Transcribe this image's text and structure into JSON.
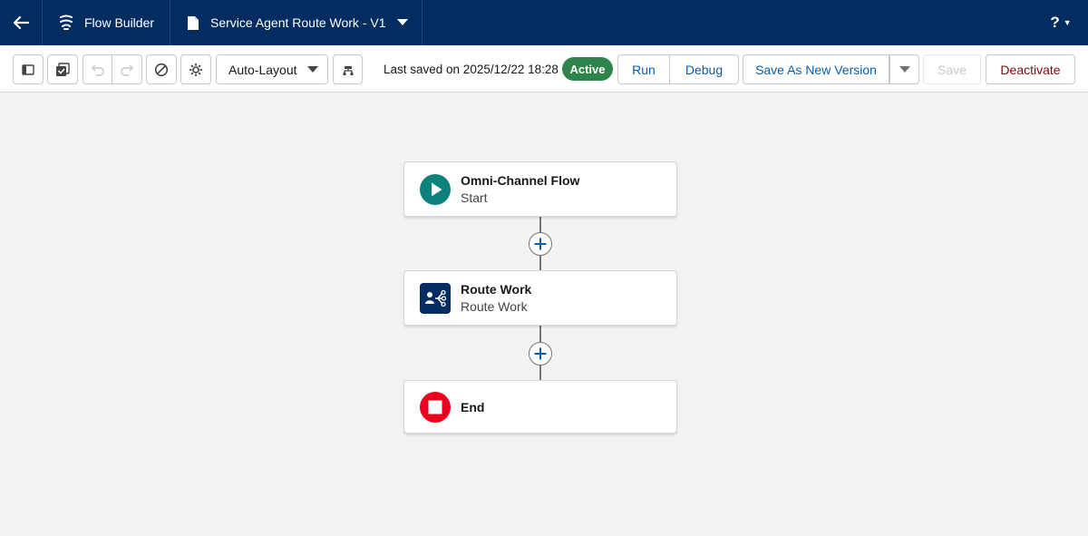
{
  "header": {
    "app_title": "Flow Builder",
    "flow_title": "Service Agent Route Work - V1",
    "help_label": "?"
  },
  "toolbar": {
    "layout_select": "Auto-Layout",
    "last_saved": "Last saved on 2025/12/22 18:28",
    "status": "Active",
    "run": "Run",
    "debug": "Debug",
    "save_as_new_version": "Save As New Version",
    "save": "Save",
    "deactivate": "Deactivate"
  },
  "nodes": [
    {
      "title": "Omni-Channel Flow",
      "subtitle": "Start",
      "icon": "start-play-icon"
    },
    {
      "title": "Route Work",
      "subtitle": "Route Work",
      "icon": "route-work-icon"
    },
    {
      "title": "End",
      "subtitle": "",
      "icon": "end-stop-icon"
    }
  ],
  "colors": {
    "header_bg": "#032d60",
    "active_badge": "#2e844a",
    "start_icon": "#0b827c",
    "route_icon": "#032d60",
    "end_icon": "#ea001e",
    "link": "#0b5cab",
    "deactivate": "#8e030f"
  }
}
